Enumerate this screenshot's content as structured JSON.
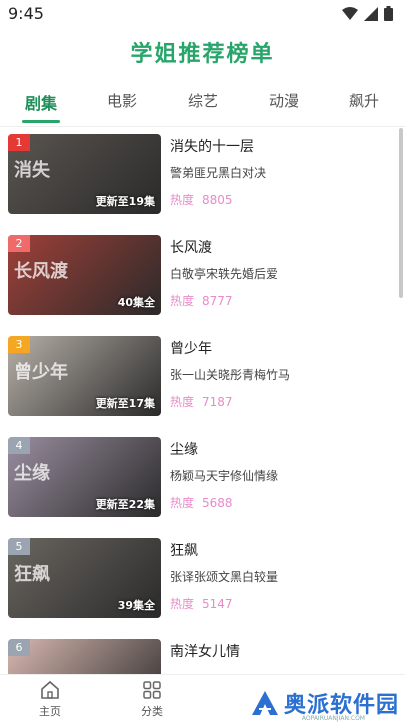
{
  "status": {
    "time": "9:45",
    "icons": [
      "wifi-icon",
      "signal-icon",
      "battery-icon"
    ]
  },
  "page_title": "学姐推荐榜单",
  "tabs": [
    {
      "label": "剧集",
      "active": true
    },
    {
      "label": "电影"
    },
    {
      "label": "综艺"
    },
    {
      "label": "动漫"
    },
    {
      "label": "飙升"
    }
  ],
  "heat_label": "热度",
  "items": [
    {
      "rank": "1",
      "title": "消失的十一层",
      "desc": "警弟匪兄黑白对决",
      "heat": "8805",
      "episodes": "更新至19集",
      "art": "消失",
      "rank_color": "#e53935",
      "thumb_color": "#5a5550"
    },
    {
      "rank": "2",
      "title": "长风渡",
      "desc": "白敬亭宋轶先婚后爱",
      "heat": "8777",
      "episodes": "40集全",
      "art": "长风渡",
      "rank_color": "#f06a6a",
      "thumb_color": "#a04038"
    },
    {
      "rank": "3",
      "title": "曾少年",
      "desc": "张一山关晓彤青梅竹马",
      "heat": "7187",
      "episodes": "更新至17集",
      "art": "曾少年",
      "rank_color": "#f5a623",
      "thumb_color": "#b7b0a8"
    },
    {
      "rank": "4",
      "title": "尘缘",
      "desc": "杨颖马天宇修仙情缘",
      "heat": "5688",
      "episodes": "更新至22集",
      "art": "尘缘",
      "rank_color": "#9aa5b1",
      "thumb_color": "#9a8ea0"
    },
    {
      "rank": "5",
      "title": "狂飙",
      "desc": "张译张颂文黑白较量",
      "heat": "5147",
      "episodes": "39集全",
      "art": "狂飙",
      "rank_color": "#9aa5b1",
      "thumb_color": "#6a6660"
    },
    {
      "rank": "6",
      "title": "南洋女儿情",
      "desc": "",
      "heat": "",
      "episodes": "",
      "art": "",
      "rank_color": "#9aa5b1",
      "thumb_color": "#d8b8b0"
    }
  ],
  "bottom_nav": [
    {
      "label": "主页",
      "icon": "home-icon"
    },
    {
      "label": "分类",
      "icon": "grid-icon"
    }
  ],
  "watermark": {
    "text": "奥派软件园",
    "url": "AOPAIRUANJIAN.COM",
    "logo": "logo-icon"
  },
  "colors": {
    "accent": "#27a56a",
    "heat": "#e88bc8",
    "watermark": "#2b6fd1"
  }
}
